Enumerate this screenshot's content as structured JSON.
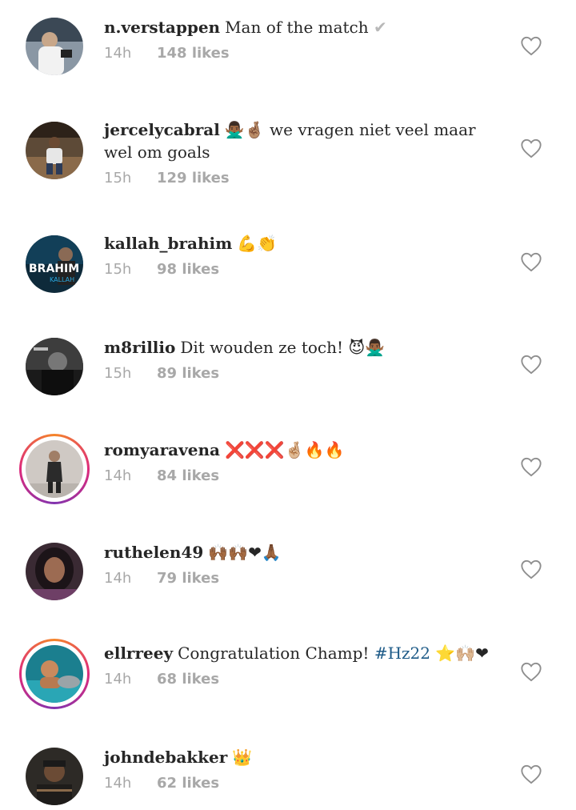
{
  "comments": [
    {
      "username": "n.verstappen",
      "text": "Man of the match",
      "emoji": "✔",
      "time": "14h",
      "likes": "148 likes",
      "story": false,
      "avatar_color": "#5b6470",
      "avatar_accent": "#e9e9e9"
    },
    {
      "username": "jercelycabral",
      "text": "we vragen niet veel maar wel om goals",
      "emoji": "🙅🏾‍♂️🤞🏽",
      "time": "15h",
      "likes": "129 likes",
      "story": false,
      "avatar_color": "#4a3b2c",
      "avatar_accent": "#c7b299"
    },
    {
      "username": "kallah_brahim",
      "text": "",
      "emoji": "💪👏",
      "time": "15h",
      "likes": "98 likes",
      "story": false,
      "avatar_color": "#0e2a3a",
      "avatar_accent": "#2aa9e0",
      "avatar_text": "BRAHIM"
    },
    {
      "username": "m8rillio",
      "text": "Dit wouden ze toch!",
      "emoji": "😈🙅🏾‍♂️",
      "time": "15h",
      "likes": "89 likes",
      "story": false,
      "avatar_color": "#1a1a1a",
      "avatar_accent": "#9a9a9a"
    },
    {
      "username": "romyaravena",
      "text": "",
      "emoji": "❌❌❌🤞🏼🔥🔥",
      "time": "14h",
      "likes": "84 likes",
      "story": true,
      "avatar_color": "#cfc9c4",
      "avatar_accent": "#2b2b2b"
    },
    {
      "username": "ruthelen49",
      "text": "",
      "emoji": "🙌🏾🙌🏾❤🙏🏾",
      "time": "14h",
      "likes": "79 likes",
      "story": false,
      "avatar_color": "#3a2a33",
      "avatar_accent": "#8e5b86"
    },
    {
      "username": "ellrreey",
      "text": "Congratulation Champ!",
      "hashtag": "#Hz22",
      "emoji": "⭐🙌🏼❤",
      "time": "14h",
      "likes": "68 likes",
      "story": true,
      "avatar_color": "#1b7f8f",
      "avatar_accent": "#c98a5d"
    },
    {
      "username": "johndebakker",
      "text": "",
      "emoji": "👑",
      "time": "14h",
      "likes": "62 likes",
      "story": false,
      "avatar_color": "#2d2a26",
      "avatar_accent": "#8a6a4a"
    }
  ]
}
